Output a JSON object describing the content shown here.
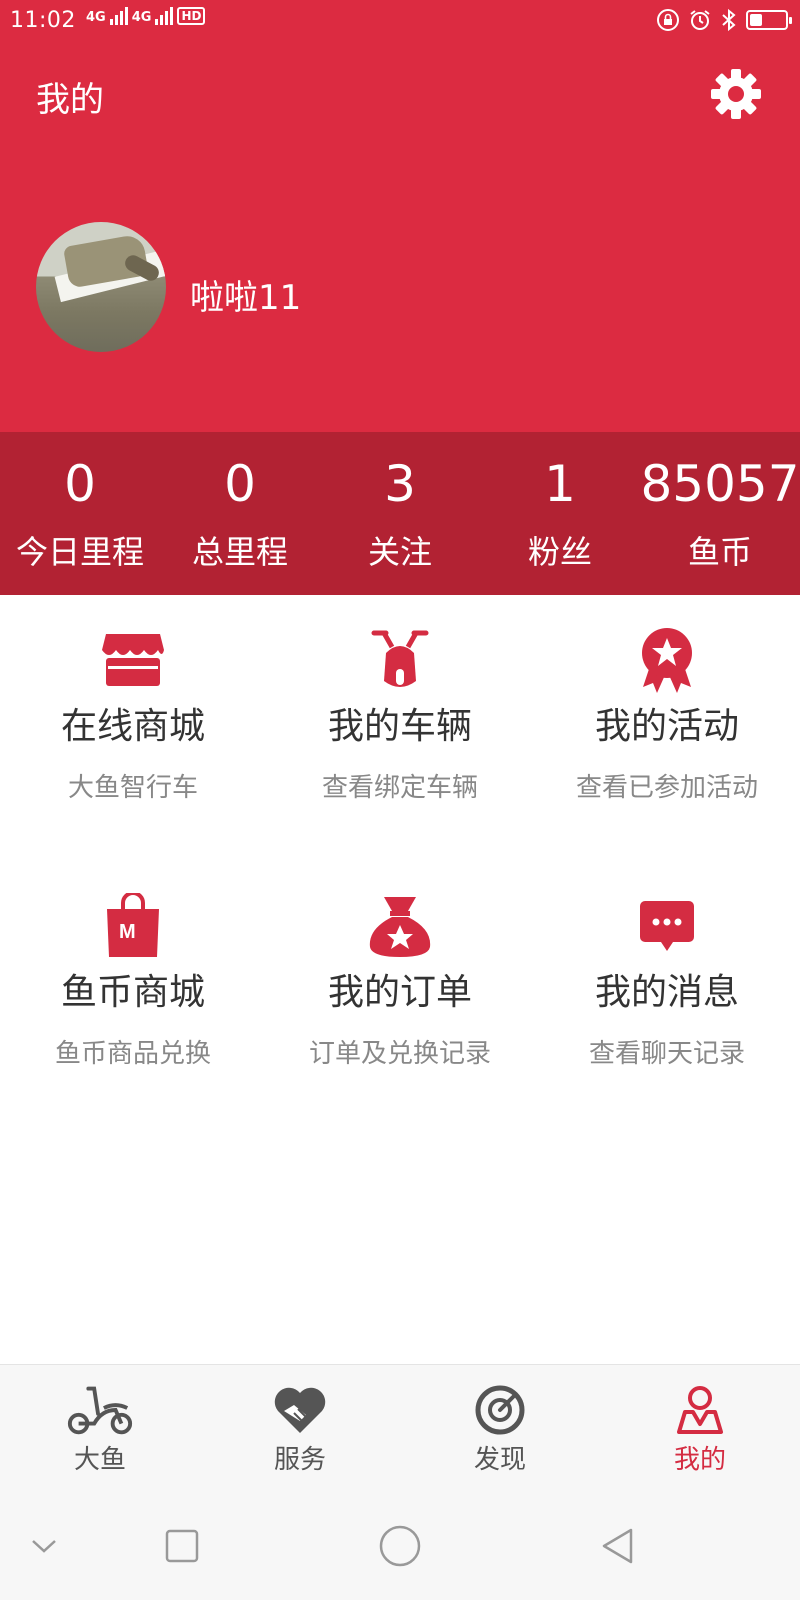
{
  "status_bar": {
    "time": "11:02",
    "network_1": "4G",
    "network_2": "4G",
    "hd_label": "HD",
    "battery_level": 0.35
  },
  "header": {
    "title": "我的",
    "settings_icon": "gear-icon"
  },
  "profile": {
    "username": "啦啦11",
    "avatar": "user-avatar-photo"
  },
  "stats": [
    {
      "value": "0",
      "label": "今日里程"
    },
    {
      "value": "0",
      "label": "总里程"
    },
    {
      "value": "3",
      "label": "关注"
    },
    {
      "value": "1",
      "label": "粉丝"
    },
    {
      "value": "85057",
      "label": "鱼币"
    }
  ],
  "menu": [
    {
      "icon": "store-icon",
      "title": "在线商城",
      "subtitle": "大鱼智行车"
    },
    {
      "icon": "scooter-icon",
      "title": "我的车辆",
      "subtitle": "查看绑定车辆"
    },
    {
      "icon": "award-medal-icon",
      "title": "我的活动",
      "subtitle": "查看已参加活动"
    },
    {
      "icon": "shopping-bag-icon",
      "title": "鱼币商城",
      "subtitle": "鱼币商品兑换"
    },
    {
      "icon": "money-bag-icon",
      "title": "我的订单",
      "subtitle": "订单及兑换记录"
    },
    {
      "icon": "chat-bubble-icon",
      "title": "我的消息",
      "subtitle": "查看聊天记录"
    }
  ],
  "tabbar": [
    {
      "icon": "scooter-outline-icon",
      "label": "大鱼",
      "active": false
    },
    {
      "icon": "handshake-heart-icon",
      "label": "服务",
      "active": false
    },
    {
      "icon": "compass-icon",
      "label": "发现",
      "active": false
    },
    {
      "icon": "user-profile-icon",
      "label": "我的",
      "active": true
    }
  ],
  "system_nav": [
    "chevron-down-icon",
    "recents-square-icon",
    "home-circle-icon",
    "back-triangle-icon"
  ],
  "colors": {
    "primary_red": "#dc2b41",
    "stats_band": "#b22233",
    "icon_red": "#d42c42",
    "text_dark": "#333333",
    "text_muted": "#888888"
  }
}
